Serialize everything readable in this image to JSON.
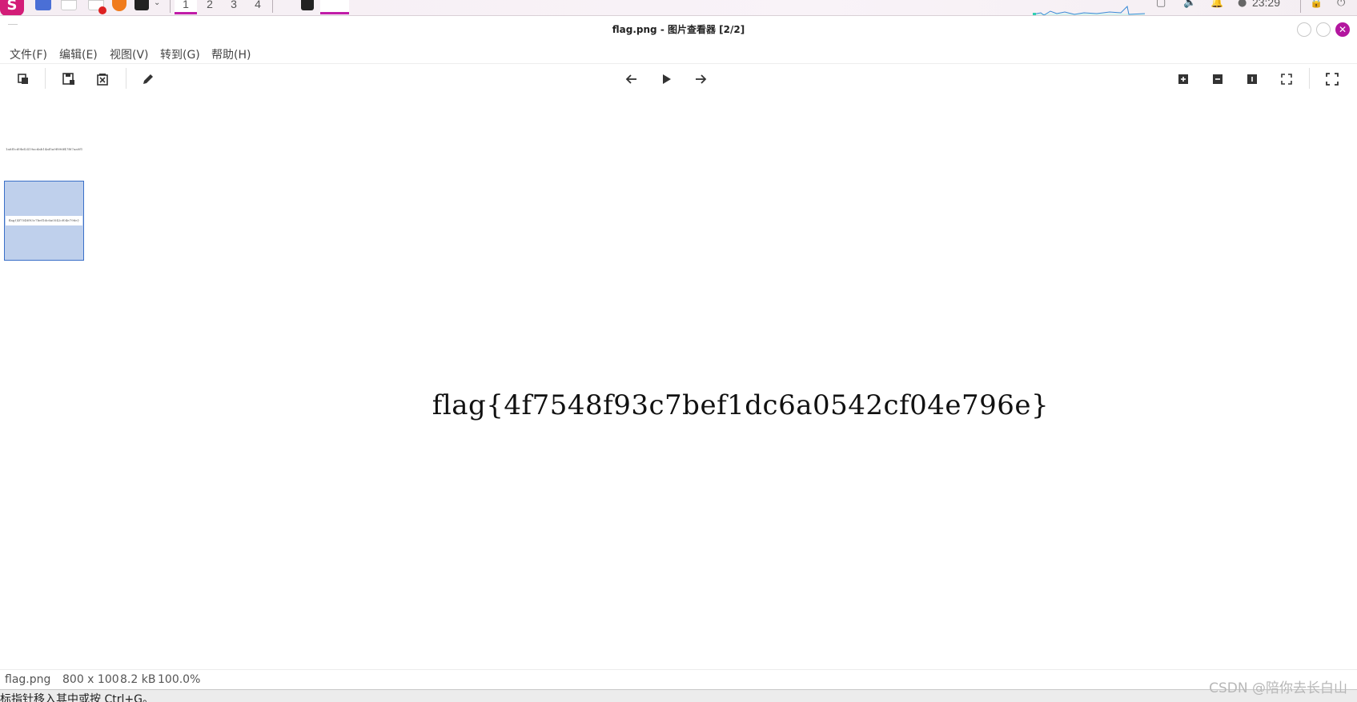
{
  "taskbar": {
    "launcher_letter": "S",
    "workspaces": [
      "1",
      "2",
      "3",
      "4"
    ],
    "active_workspace": "1",
    "clock": "23:29",
    "accent_color": "#c01ca8"
  },
  "window": {
    "title": "flag.png - 图片查看器 [2/2]",
    "close_glyph": "✕"
  },
  "menu": {
    "items": [
      "文件(F)",
      "编辑(E)",
      "视图(V)",
      "转到(G)",
      "帮助(H)"
    ]
  },
  "toolbar": {
    "left_tools": [
      "copy-icon",
      "save-icon",
      "delete-icon",
      "edit-pencil-icon"
    ],
    "center_tools": [
      "arrow-left-icon",
      "play-icon",
      "arrow-right-icon"
    ],
    "right_tools": [
      "zoom-in-icon",
      "zoom-out-icon",
      "zoom-original-icon",
      "zoom-fit-icon",
      "fullscreen-icon"
    ]
  },
  "thumbnails": [
    {
      "caption": "1a6f5cd9bd2419acdab14af5a9f896f47f67aa0f1",
      "selected": false
    },
    {
      "caption": "flag{4f7548f93c7bef1dc6a0542cf04e796e}",
      "selected": true
    }
  ],
  "image": {
    "text": "flag{4f7548f93c7bef1dc6a0542cf04e796e}"
  },
  "status": {
    "filename": "flag.png",
    "dimensions": "800 x 100",
    "size": "8.2 kB",
    "zoom": "100.0%"
  },
  "bottom_hint": "标指针移入其中或按 Ctrl+G。",
  "watermark": "CSDN @陪你去长白山"
}
